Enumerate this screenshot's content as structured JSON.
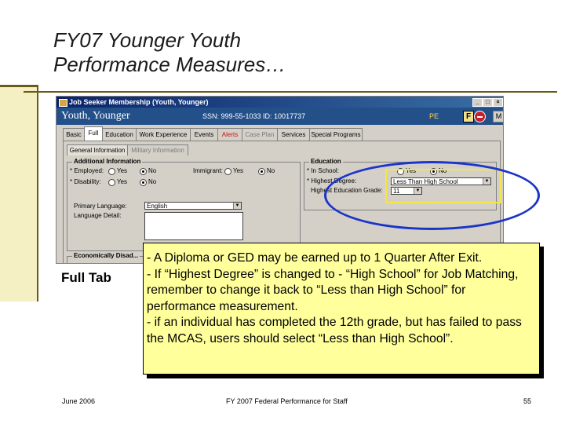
{
  "slide": {
    "title_line1": "FY07 Younger Youth",
    "title_line2": "Performance Measures…",
    "side_label": "Full Tab"
  },
  "app": {
    "window_title": "Job Seeker Membership (Youth, Younger)",
    "header_name": "Youth, Younger",
    "ssn_text": "SSN: 999-55-1033   ID: 10017737",
    "pe_label": "PE",
    "f_label": "F",
    "m_label": "M",
    "tabs": [
      "Basic",
      "Full",
      "Education",
      "Work Experience",
      "Events",
      "Alerts",
      "Case Plan",
      "Services",
      "Special Programs"
    ],
    "subtabs": [
      "General Information",
      "Military Information"
    ],
    "additional": {
      "title": "Additional Information",
      "employed_label": "* Employed:",
      "disability_label": "* Disability:",
      "immigrant_label": "Immigrant:",
      "yes": "Yes",
      "no": "No",
      "primary_language_label": "Primary Language:",
      "primary_language_value": "English",
      "language_detail_label": "Language Detail:"
    },
    "education": {
      "title": "Education",
      "in_school_label": "* In School:",
      "yes": "Yes",
      "no": "No",
      "highest_degree_label": "* Highest Degree:",
      "highest_degree_value": "Less Than High School",
      "highest_grade_label": "Highest Education Grade:",
      "highest_grade_value": "11"
    },
    "econ_group_title": "Economically Disad..."
  },
  "callout": {
    "line1": "- A Diploma or GED may be earned up to 1 Quarter After Exit.",
    "line2": "- If “Highest Degree” is changed to - “High School” for Job Matching, remember to change it back to “Less than High School” for performance measurement.",
    "line3": " - if an individual has completed the 12th grade, but has failed to pass the MCAS, users should select “Less than High School”."
  },
  "footer": {
    "date": "June 2006",
    "center": "FY 2007 Federal Performance for Staff",
    "page": "55"
  },
  "colors": {
    "accent": "#6b5a1a",
    "callout_bg": "#ffff9c",
    "ellipse": "#1c35c8",
    "header_bg": "#24508a"
  }
}
